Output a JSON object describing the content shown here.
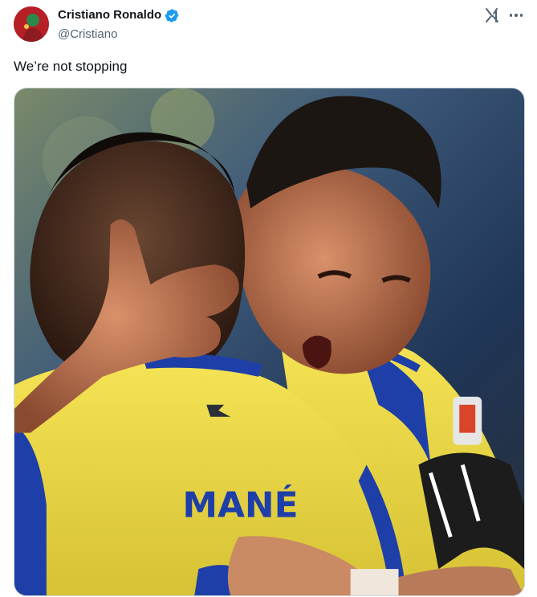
{
  "author": {
    "display_name": "Cristiano Ronaldo",
    "handle": "@Cristiano",
    "verified": true,
    "avatar_icon": "profile-avatar"
  },
  "actions": {
    "grok_icon": "grok-icon",
    "more_icon": "more-options-icon"
  },
  "tweet": {
    "text": "We’re not stopping"
  },
  "media": {
    "description_icon": "photo-two-players-embracing",
    "jersey_name": "MANÉ"
  },
  "colors": {
    "verified_blue": "#1d9bf0",
    "text_primary": "#0f1419",
    "text_secondary": "#536471",
    "jersey_yellow": "#f4e04a",
    "jersey_blue": "#1f3fa8"
  }
}
